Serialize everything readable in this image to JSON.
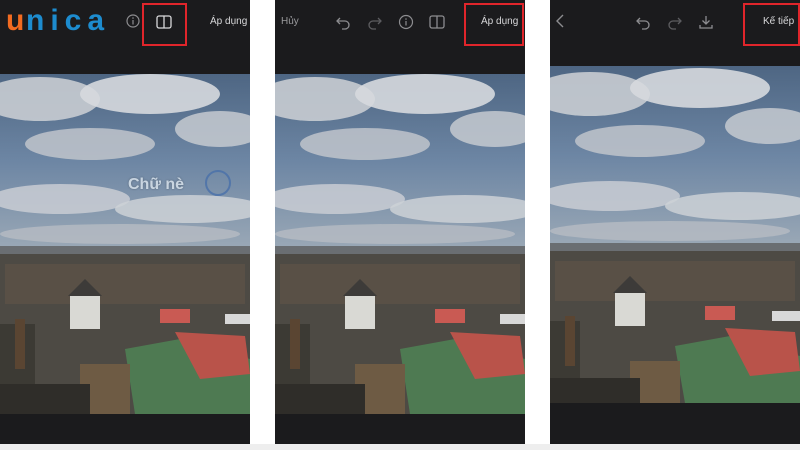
{
  "logo": {
    "text": "unica"
  },
  "panel1": {
    "apply_label": "Áp dụng",
    "overlay_text": "Chữ nè"
  },
  "panel2": {
    "cancel_label": "Hủy",
    "apply_label": "Áp dụng"
  },
  "panel3": {
    "next_label": "Kế tiếp"
  },
  "icons": {
    "compare": "compare-split-icon",
    "undo": "undo-icon",
    "redo": "redo-icon",
    "info": "info-icon",
    "back": "chevron-left-icon",
    "download": "download-icon"
  },
  "colors": {
    "highlight": "#e0252b",
    "logo_orange": "#f26b21",
    "logo_blue": "#1d8ccf",
    "toolbar_bg": "#1b1b1d"
  }
}
